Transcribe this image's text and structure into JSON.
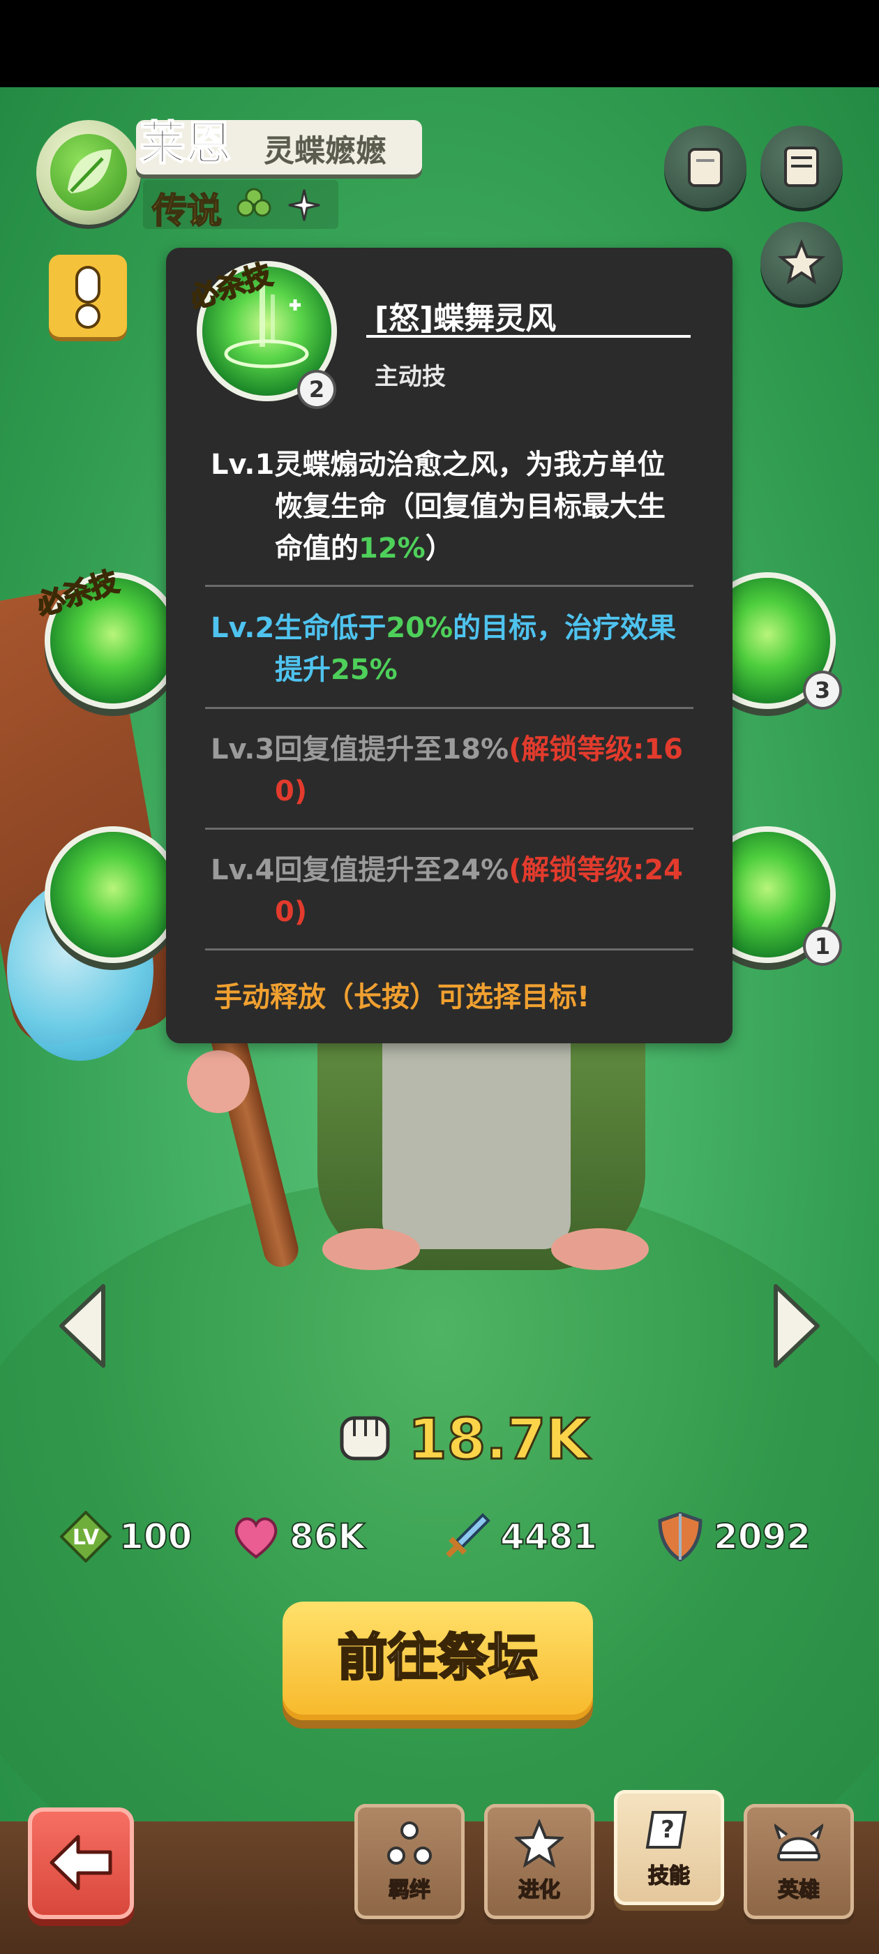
{
  "hero": {
    "name": "莱恩",
    "title": "灵蝶嬷嬷",
    "rarity": "传说"
  },
  "skill_tooltip": {
    "ult_label": "必杀技",
    "orb_level": "2",
    "name": "[怒]蝶舞灵风",
    "type": "主动技",
    "levels": [
      {
        "prefix": "Lv.1灵蝶煽动治愈之风，为我方单位",
        "line2": "恢复生命（回复值为目标最大生",
        "line3_pre": "命值的",
        "highlight": "12%",
        "line3_post": "）"
      },
      {
        "line1_pre": "Lv.2生命低于",
        "hl1": "20%",
        "line1_mid": "的目标，治疗效果",
        "line2_pre": "提升",
        "hl2": "25%"
      },
      {
        "line1_pre": "Lv.3回复值提升至18%",
        "lock1": "(解锁等级:16",
        "lock2": "0)"
      },
      {
        "line1_pre": "Lv.4回复值提升至24%",
        "lock1": "(解锁等级:24",
        "lock2": "0)"
      }
    ],
    "footer": "手动释放（长按）可选择目标!"
  },
  "side_skills": {
    "left_ult_label": "必杀技",
    "right_top_num": "3",
    "right_bottom_num": "1"
  },
  "power": "18.7K",
  "stats": {
    "level": "100",
    "hp": "86K",
    "attack": "4481",
    "defense": "2092",
    "level_badge": "LV"
  },
  "altar_button": "前往祭坛",
  "tabs": [
    "羁绊",
    "进化",
    "技能",
    "英雄"
  ],
  "active_tab": "技能",
  "colors": {
    "gold": "#fbd44a",
    "tooltip_bg": "#2b2b2b",
    "lv2_blue": "#4fc3ef",
    "highlight_green": "#4ed05a",
    "lock_red": "#e23b2d",
    "footer_orange": "#f0a030"
  }
}
